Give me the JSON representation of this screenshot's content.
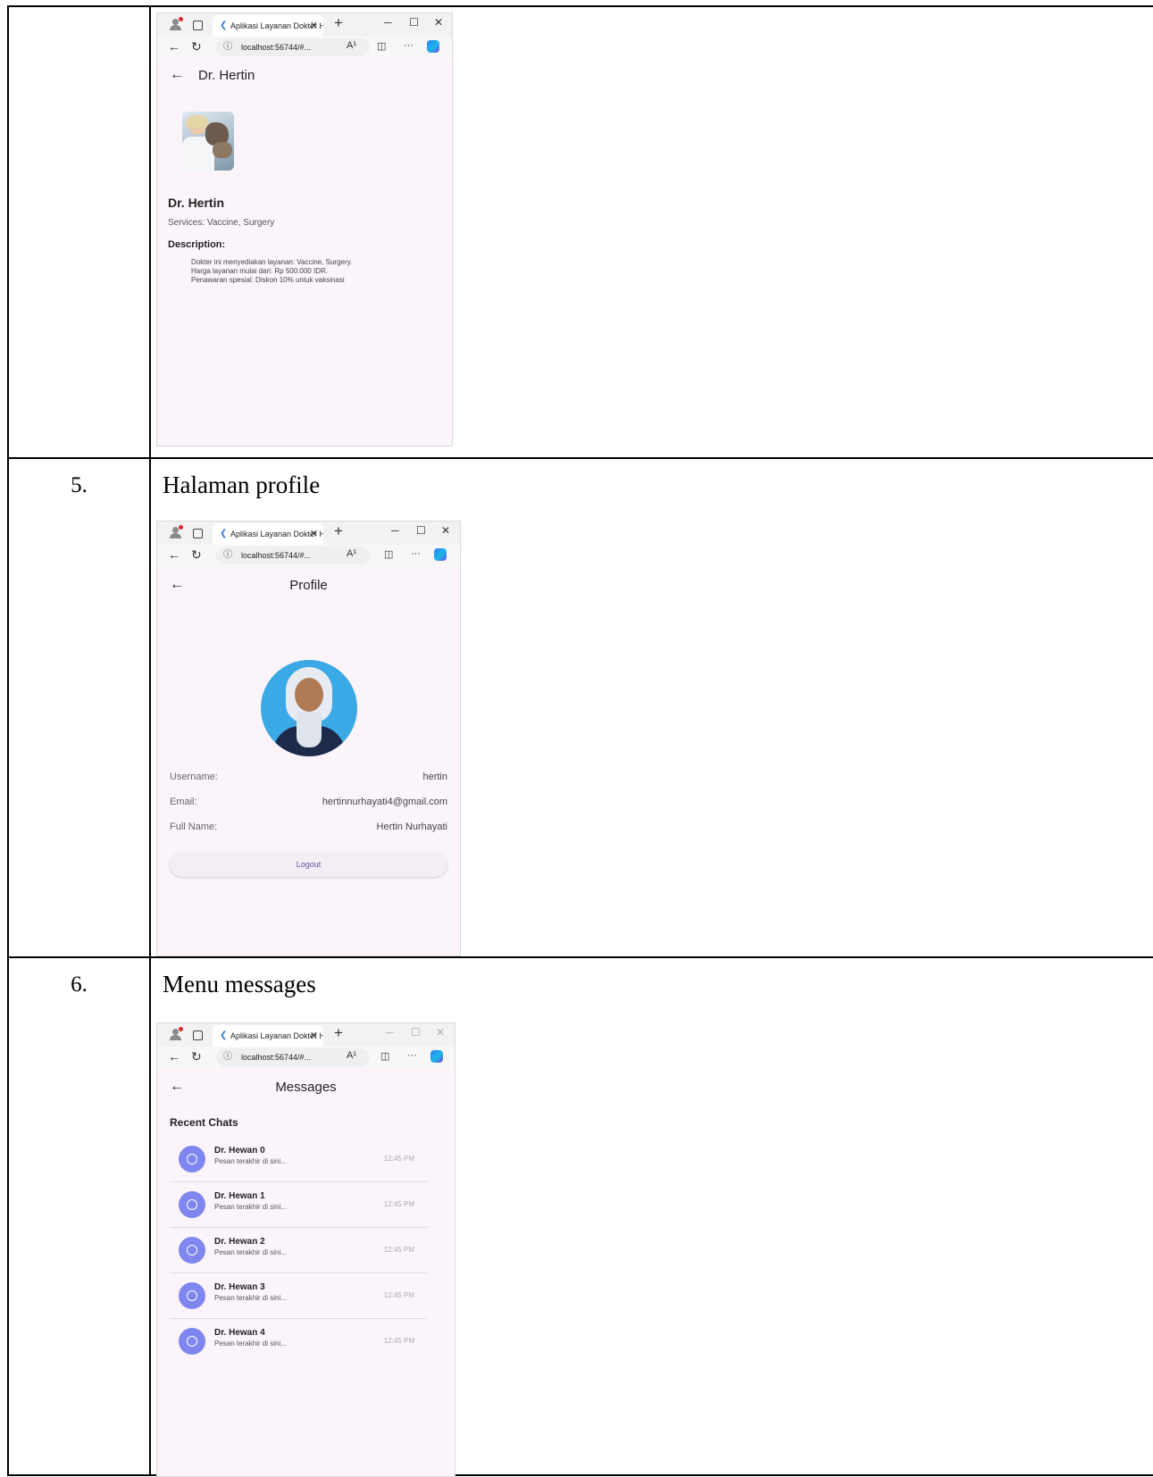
{
  "rows": [
    {
      "number": "",
      "title": ""
    },
    {
      "number": "5.",
      "title": "Halaman profile"
    },
    {
      "number": "6.",
      "title": "Menu messages"
    }
  ],
  "browser": {
    "tab_title": "Aplikasi Layanan Dokter H",
    "url": "localhost:56744/#...",
    "read_aloud": "A¹",
    "more": "···"
  },
  "detail": {
    "appbar_title": "Dr. Hertin",
    "name": "Dr. Hertin",
    "services": "Services: Vaccine, Surgery",
    "description_heading": "Description:",
    "description_lines": [
      "Dokter ini menyediakan layanan: Vaccine, Surgery.",
      "Harga layanan mulai dari: Rp 500.000 IDR.",
      "Penawaran spesial: Diskon 10% untuk vaksinasi"
    ]
  },
  "profile": {
    "appbar_title": "Profile",
    "fields": [
      {
        "label": "Username:",
        "value": "hertin"
      },
      {
        "label": "Email:",
        "value": "hertinnurhayati4@gmail.com"
      },
      {
        "label": "Full Name:",
        "value": "Hertin Nurhayati"
      }
    ],
    "logout_label": "Logout"
  },
  "messages": {
    "appbar_title": "Messages",
    "section_title": "Recent Chats",
    "chats": [
      {
        "name": "Dr. Hewan 0",
        "message": "Pesan terakhir di sini...",
        "time": "12:45 PM"
      },
      {
        "name": "Dr. Hewan 1",
        "message": "Pesan terakhir di sini...",
        "time": "12:45 PM"
      },
      {
        "name": "Dr. Hewan 2",
        "message": "Pesan terakhir di sini...",
        "time": "12:45 PM"
      },
      {
        "name": "Dr. Hewan 3",
        "message": "Pesan terakhir di sini...",
        "time": "12:45 PM"
      },
      {
        "name": "Dr. Hewan 4",
        "message": "Pesan terakhir di sini...",
        "time": "12:45 PM"
      }
    ]
  },
  "colors": {
    "app_background": "#fcf4fb",
    "chat_avatar": "#7f86ef",
    "logout_text": "#6750a4"
  }
}
